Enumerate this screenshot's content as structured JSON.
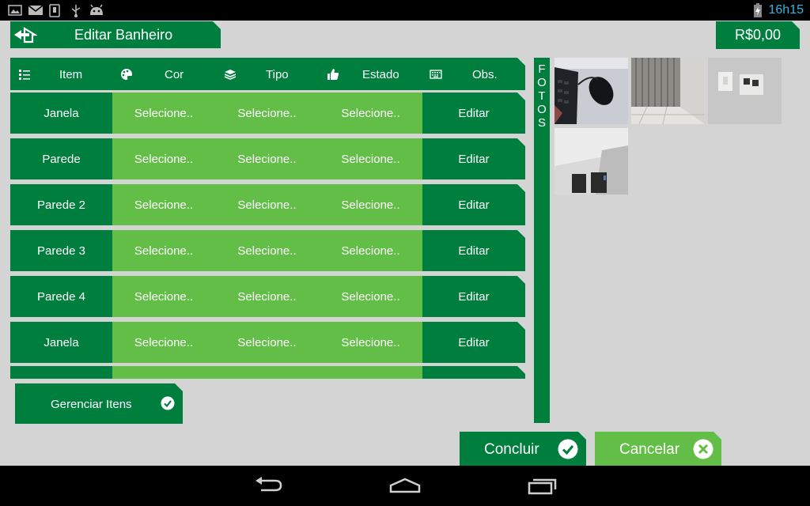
{
  "status_bar": {
    "time": "16h15",
    "icons": [
      "gallery-icon",
      "gmail-icon",
      "download-icon",
      "usb-icon",
      "android-debug-icon",
      "battery-charging-icon"
    ]
  },
  "header": {
    "title": "Editar Banheiro",
    "back_icon": "home-back-icon",
    "price": "R$0,00"
  },
  "table": {
    "columns": [
      {
        "label": "Item",
        "icon": "list-icon"
      },
      {
        "label": "Cor",
        "icon": "palette-icon"
      },
      {
        "label": "Tipo",
        "icon": "layers-icon"
      },
      {
        "label": "Estado",
        "icon": "thumbs-up-icon"
      },
      {
        "label": "Obs.",
        "icon": "keyboard-icon"
      }
    ],
    "rows": [
      {
        "item": "Janela",
        "cor": "Selecione..",
        "tipo": "Selecione..",
        "estado": "Selecione..",
        "obs": "Editar"
      },
      {
        "item": "Parede",
        "cor": "Selecione..",
        "tipo": "Selecione..",
        "estado": "Selecione..",
        "obs": "Editar"
      },
      {
        "item": "Parede 2",
        "cor": "Selecione..",
        "tipo": "Selecione..",
        "estado": "Selecione..",
        "obs": "Editar"
      },
      {
        "item": "Parede 3",
        "cor": "Selecione..",
        "tipo": "Selecione..",
        "estado": "Selecione..",
        "obs": "Editar"
      },
      {
        "item": "Parede 4",
        "cor": "Selecione..",
        "tipo": "Selecione..",
        "estado": "Selecione..",
        "obs": "Editar"
      },
      {
        "item": "Janela",
        "cor": "Selecione..",
        "tipo": "Selecione..",
        "estado": "Selecione..",
        "obs": "Editar"
      }
    ]
  },
  "manage_items": {
    "label": "Gerenciar Itens",
    "icon": "check-circle-icon"
  },
  "photos": {
    "label": "FOTOS",
    "letters": [
      "F",
      "O",
      "T",
      "O",
      "S"
    ]
  },
  "actions": {
    "concluir": {
      "label": "Concluir",
      "icon": "check-circle-icon"
    },
    "cancelar": {
      "label": "Cancelar",
      "icon": "close-circle-icon"
    }
  },
  "nav_bar": {
    "icons": [
      "back-icon",
      "home-icon",
      "recent-apps-icon"
    ]
  },
  "colors": {
    "dark_green": "#007e3e",
    "light_green": "#62be46",
    "background": "#d4d4d4",
    "clock": "#33b5e5"
  }
}
